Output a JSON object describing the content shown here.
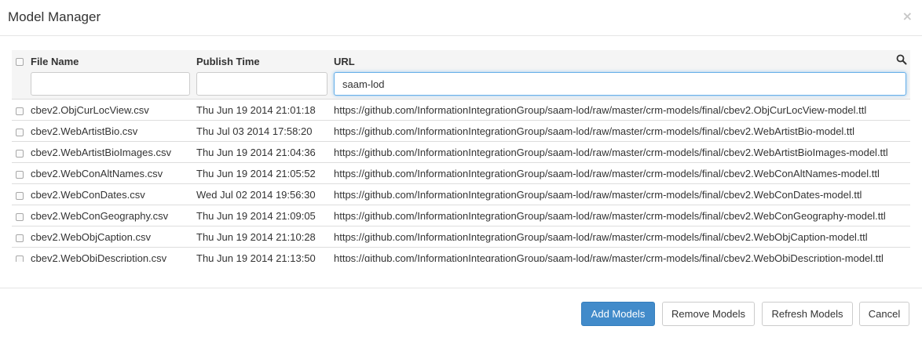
{
  "modal": {
    "title": "Model Manager",
    "close_glyph": "×"
  },
  "table": {
    "columns": [
      "File Name",
      "Publish Time",
      "URL"
    ],
    "filters": {
      "file_name": "",
      "publish_time": "",
      "url": "saam-lod"
    },
    "rows": [
      {
        "file": "cbev2.ObjCurLocView.csv",
        "time": "Thu Jun 19 2014 21:01:18",
        "url": "https://github.com/InformationIntegrationGroup/saam-lod/raw/master/crm-models/final/cbev2.ObjCurLocView-model.ttl"
      },
      {
        "file": "cbev2.WebArtistBio.csv",
        "time": "Thu Jul 03 2014 17:58:20",
        "url": "https://github.com/InformationIntegrationGroup/saam-lod/raw/master/crm-models/final/cbev2.WebArtistBio-model.ttl"
      },
      {
        "file": "cbev2.WebArtistBioImages.csv",
        "time": "Thu Jun 19 2014 21:04:36",
        "url": "https://github.com/InformationIntegrationGroup/saam-lod/raw/master/crm-models/final/cbev2.WebArtistBioImages-model.ttl"
      },
      {
        "file": "cbev2.WebConAltNames.csv",
        "time": "Thu Jun 19 2014 21:05:52",
        "url": "https://github.com/InformationIntegrationGroup/saam-lod/raw/master/crm-models/final/cbev2.WebConAltNames-model.ttl"
      },
      {
        "file": "cbev2.WebConDates.csv",
        "time": "Wed Jul 02 2014 19:56:30",
        "url": "https://github.com/InformationIntegrationGroup/saam-lod/raw/master/crm-models/final/cbev2.WebConDates-model.ttl"
      },
      {
        "file": "cbev2.WebConGeography.csv",
        "time": "Thu Jun 19 2014 21:09:05",
        "url": "https://github.com/InformationIntegrationGroup/saam-lod/raw/master/crm-models/final/cbev2.WebConGeography-model.ttl"
      },
      {
        "file": "cbev2.WebObjCaption.csv",
        "time": "Thu Jun 19 2014 21:10:28",
        "url": "https://github.com/InformationIntegrationGroup/saam-lod/raw/master/crm-models/final/cbev2.WebObjCaption-model.ttl"
      },
      {
        "file": "cbev2.WebObjDescription.csv",
        "time": "Thu Jun 19 2014 21:13:50",
        "url": "https://github.com/InformationIntegrationGroup/saam-lod/raw/master/crm-models/final/cbev2.WebObjDescription-model.ttl"
      }
    ]
  },
  "footer": {
    "add_label": "Add Models",
    "remove_label": "Remove Models",
    "refresh_label": "Refresh Models",
    "cancel_label": "Cancel"
  },
  "colors": {
    "primary": "#428bca",
    "focus": "#66afe9"
  },
  "icons": [
    "close-icon",
    "search-icon"
  ]
}
